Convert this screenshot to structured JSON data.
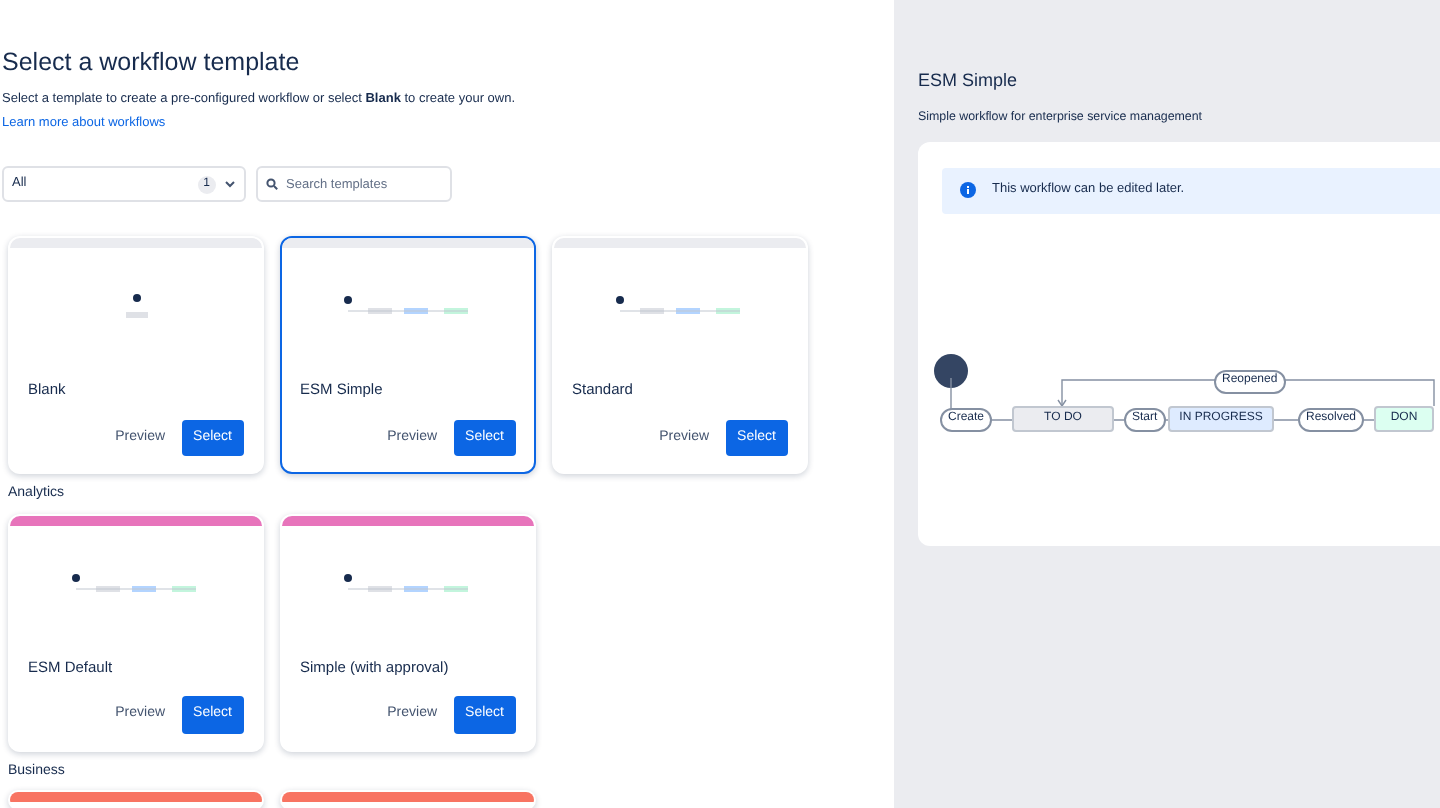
{
  "header": {
    "title": "Select a workflow template",
    "description": "Select a template to create a pre-configured workflow or select **Blank** to create your own.",
    "link": "Learn more about workflows"
  },
  "filters": {
    "category": {
      "value": "All",
      "count": "1"
    },
    "search": {
      "placeholder": "Search templates"
    }
  },
  "sections": [
    {
      "color": "#ebecf0",
      "cards": [
        {
          "name": "Blank",
          "selected": false,
          "preview": "Preview",
          "select": "Select"
        },
        {
          "name": "ESM Simple",
          "selected": true,
          "preview": "Preview",
          "select": "Select"
        },
        {
          "name": "Standard",
          "selected": false,
          "preview": "Preview",
          "select": "Select"
        }
      ]
    },
    {
      "heading": "Analytics",
      "color": "#e774bb",
      "cards": [
        {
          "name": "ESM Default",
          "selected": false,
          "preview": "Preview",
          "select": "Select"
        },
        {
          "name": "Simple (with approval)",
          "selected": false,
          "preview": "Preview",
          "select": "Select"
        }
      ]
    },
    {
      "heading": "Business",
      "color": "#f87462",
      "cards": [
        {
          "selected": false
        },
        {
          "selected": false
        }
      ]
    }
  ],
  "detail": {
    "title": "ESM Simple",
    "description": "Simple workflow for enterprise service management",
    "notice": "This workflow can be edited later.",
    "diagram": {
      "transitions": [
        "Create",
        "Start",
        "Resolved"
      ],
      "statuses": [
        {
          "name": "TO DO",
          "color": "#ebecf0"
        },
        {
          "name": "IN PROGRESS",
          "color": "#deebff"
        },
        {
          "name": "DON",
          "color": "#dcfff1"
        }
      ],
      "loop": "Reopened"
    }
  }
}
